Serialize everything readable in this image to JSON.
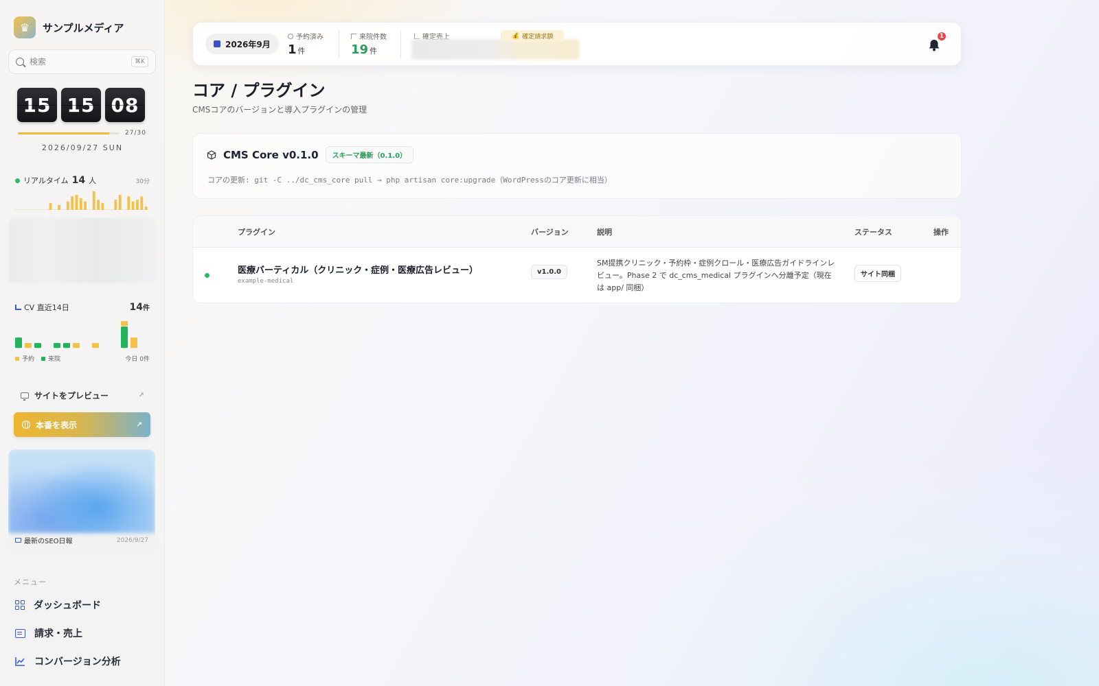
{
  "sidebar": {
    "brand_name": "サンプルメディア",
    "search": {
      "placeholder": "検索",
      "shortcut": "⌘K"
    },
    "clock": {
      "hours": "15",
      "minutes": "15",
      "seconds": "08"
    },
    "month_progress": {
      "label": "27/30",
      "fraction": 0.9
    },
    "date": "2026/09/27 SUN",
    "realtime": {
      "label": "リアルタイム",
      "count": "14",
      "unit": "人",
      "window": "30分",
      "bars": [
        0,
        0,
        0,
        0,
        0,
        0,
        0,
        0,
        4,
        0,
        3,
        0,
        5,
        8,
        9,
        7,
        5,
        0,
        11,
        6,
        4,
        0,
        0,
        6,
        9,
        0,
        8,
        5,
        6,
        8,
        2
      ]
    },
    "cv": {
      "label": "CV 直近14日",
      "total": "14",
      "total_unit": "件",
      "days": [
        {
          "visit": 2,
          "reserve": 0
        },
        {
          "visit": 0,
          "reserve": 1
        },
        {
          "visit": 1,
          "reserve": 0
        },
        {
          "visit": 0,
          "reserve": 0
        },
        {
          "visit": 1,
          "reserve": 0
        },
        {
          "visit": 1,
          "reserve": 0
        },
        {
          "visit": 0,
          "reserve": 1
        },
        {
          "visit": 0,
          "reserve": 0
        },
        {
          "visit": 0,
          "reserve": 1
        },
        {
          "visit": 0,
          "reserve": 0
        },
        {
          "visit": 0,
          "reserve": 0
        },
        {
          "visit": 4,
          "reserve": 1
        },
        {
          "visit": 0,
          "reserve": 2
        },
        {
          "visit": 0,
          "reserve": 0
        }
      ],
      "legend_reserve": "予約",
      "legend_visit": "来院",
      "today": "今日 0件",
      "colors": {
        "reserve": "#f2c14a",
        "visit": "#22b35c"
      }
    },
    "preview_label": "サイトをプレビュー",
    "production_label": "本番を表示",
    "seo": {
      "title": "最新のSEO日報",
      "date": "2026/9/27"
    },
    "menu_label": "メニュー",
    "nav": [
      {
        "label": "ダッシュボード"
      },
      {
        "label": "請求・売上"
      },
      {
        "label": "コンバージョン分析"
      }
    ]
  },
  "header": {
    "month": "2026年9月",
    "reserved": {
      "label": "予約済み",
      "value": "1",
      "unit": "件"
    },
    "visits": {
      "label": "来院件数",
      "value": "19",
      "unit": "件"
    },
    "sales": {
      "label": "確定売上"
    },
    "billing": {
      "label": "確定請求額"
    },
    "notifications": "1"
  },
  "main": {
    "title": "コア / プラグイン",
    "subtitle": "CMSコアのバージョンと導入プラグインの管理",
    "core": {
      "title": "CMS Core v0.1.0",
      "schema_badge": "スキーマ最新（0.1.0）",
      "command": "コアの更新: git -C ../dc_cms_core pull → php artisan core:upgrade（WordPressのコア更新に相当）"
    },
    "table": {
      "headers": [
        "プラグイン",
        "バージョン",
        "説明",
        "ステータス",
        "操作"
      ],
      "rows": [
        {
          "name": "医療バーティカル（クリニック・症例・医療広告レビュー）",
          "slug": "example-medical",
          "version": "v1.0.0",
          "description": "SM提携クリニック・予約枠・症例クロール・医療広告ガイドラインレビュー。Phase 2 で dc_cms_medical プラグインへ分離予定（現在は app/ 同梱）",
          "status": "サイト同梱"
        }
      ]
    }
  }
}
